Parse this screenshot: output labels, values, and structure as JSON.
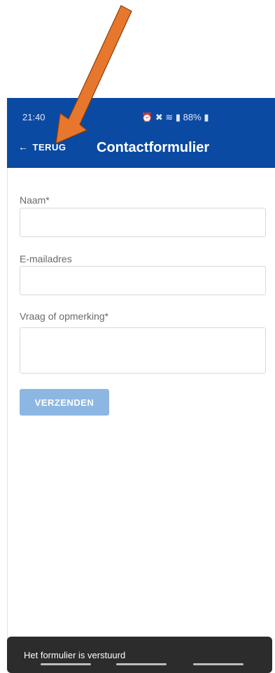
{
  "status_bar": {
    "time": "21:40",
    "battery": "88%"
  },
  "header": {
    "back_label": "TERUG",
    "back_arrow": "←",
    "title": "Contactformulier"
  },
  "form": {
    "name_label": "Naam*",
    "email_label": "E-mailadres",
    "question_label": "Vraag of opmerking*",
    "submit_label": "VERZENDEN"
  },
  "toast": {
    "message": "Het formulier is verstuurd"
  },
  "colors": {
    "appbar": "#0a4aa3",
    "submit_disabled": "#8db7e3",
    "annotation_arrow": "#e8772e"
  }
}
